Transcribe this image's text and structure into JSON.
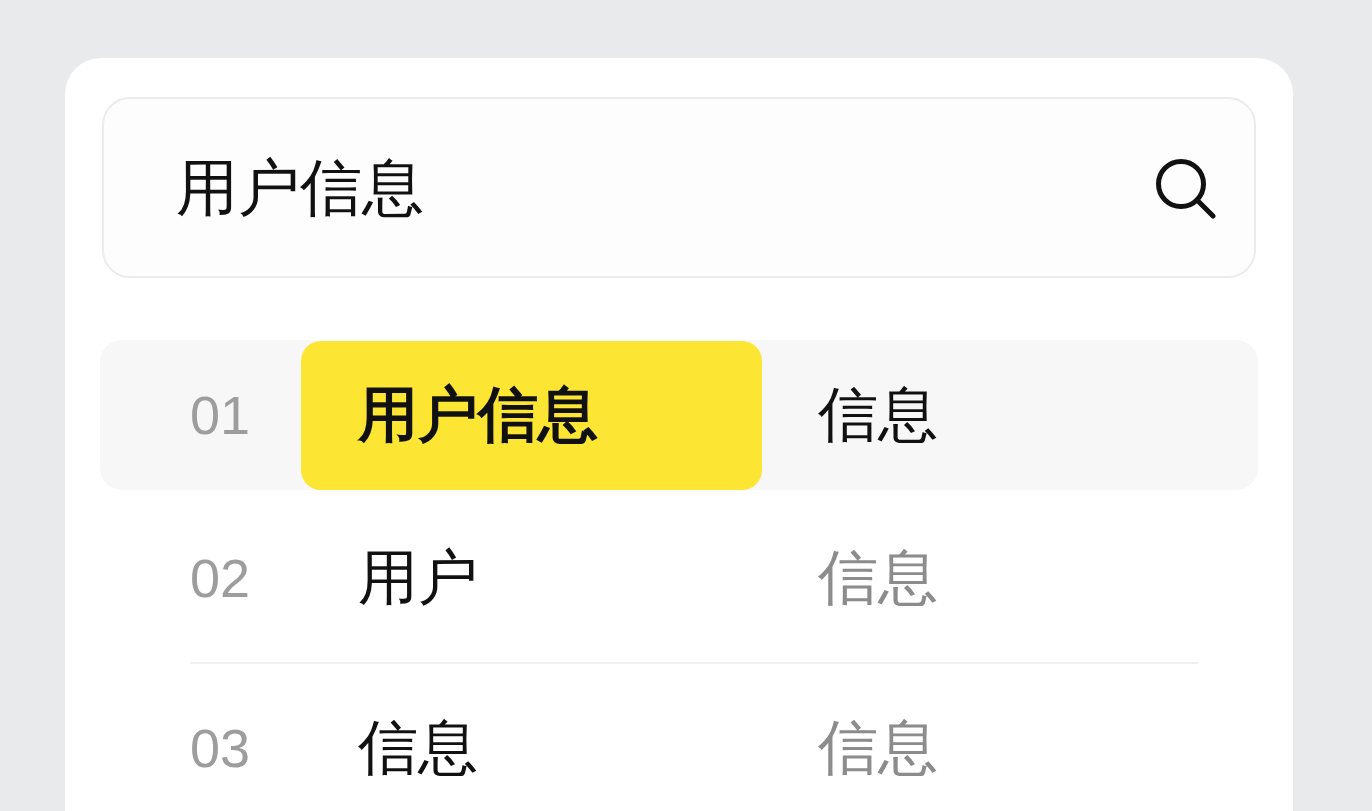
{
  "search": {
    "value": "用户信息"
  },
  "results": [
    {
      "index": "01",
      "primary": "用户信息",
      "secondary": "信息",
      "selected": true
    },
    {
      "index": "02",
      "primary": "用户",
      "secondary": "信息",
      "selected": false
    },
    {
      "index": "03",
      "primary": "信息",
      "secondary": "信息",
      "selected": false
    }
  ]
}
